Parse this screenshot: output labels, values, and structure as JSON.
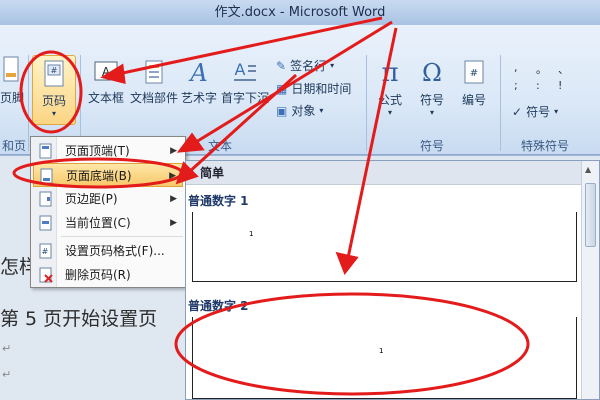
{
  "window": {
    "title": "作文.docx - Microsoft Word"
  },
  "ribbon": {
    "left_partial_label": "页脚",
    "page_number_button": "页码",
    "group_left_partial": "和页",
    "text_group": {
      "label": "文本",
      "textbox": "文本框",
      "quickparts": "文档部件",
      "wordart": "艺术字",
      "dropcap": "首字下沉",
      "signature": "签名行",
      "datetime": "日期和时间",
      "object": "对象"
    },
    "symbols_group": {
      "label": "符号",
      "equation": "公式",
      "symbol": "符号",
      "number": "编号"
    },
    "special_group": {
      "label": "特殊符号",
      "symbol": "符号"
    }
  },
  "menu": {
    "items": [
      {
        "label": "页面顶端(T)",
        "has_submenu": true
      },
      {
        "label": "页面底端(B)",
        "has_submenu": true
      },
      {
        "label": "页边距(P)",
        "has_submenu": true
      },
      {
        "label": "当前位置(C)",
        "has_submenu": true
      },
      {
        "label": "设置页码格式(F)..."
      },
      {
        "label": "删除页码(R)"
      }
    ]
  },
  "gallery": {
    "header": "简单",
    "items": [
      {
        "caption": "普通数字 1",
        "number": "1"
      },
      {
        "caption": "普通数字 2",
        "number": "1"
      }
    ]
  },
  "document": {
    "line1": "怎样",
    "line2": "第 5 页开始设置页",
    "paragraph_mark": "↵"
  },
  "colors": {
    "annotation": "#e31b1b",
    "menu_highlight": "#f8c86a"
  }
}
